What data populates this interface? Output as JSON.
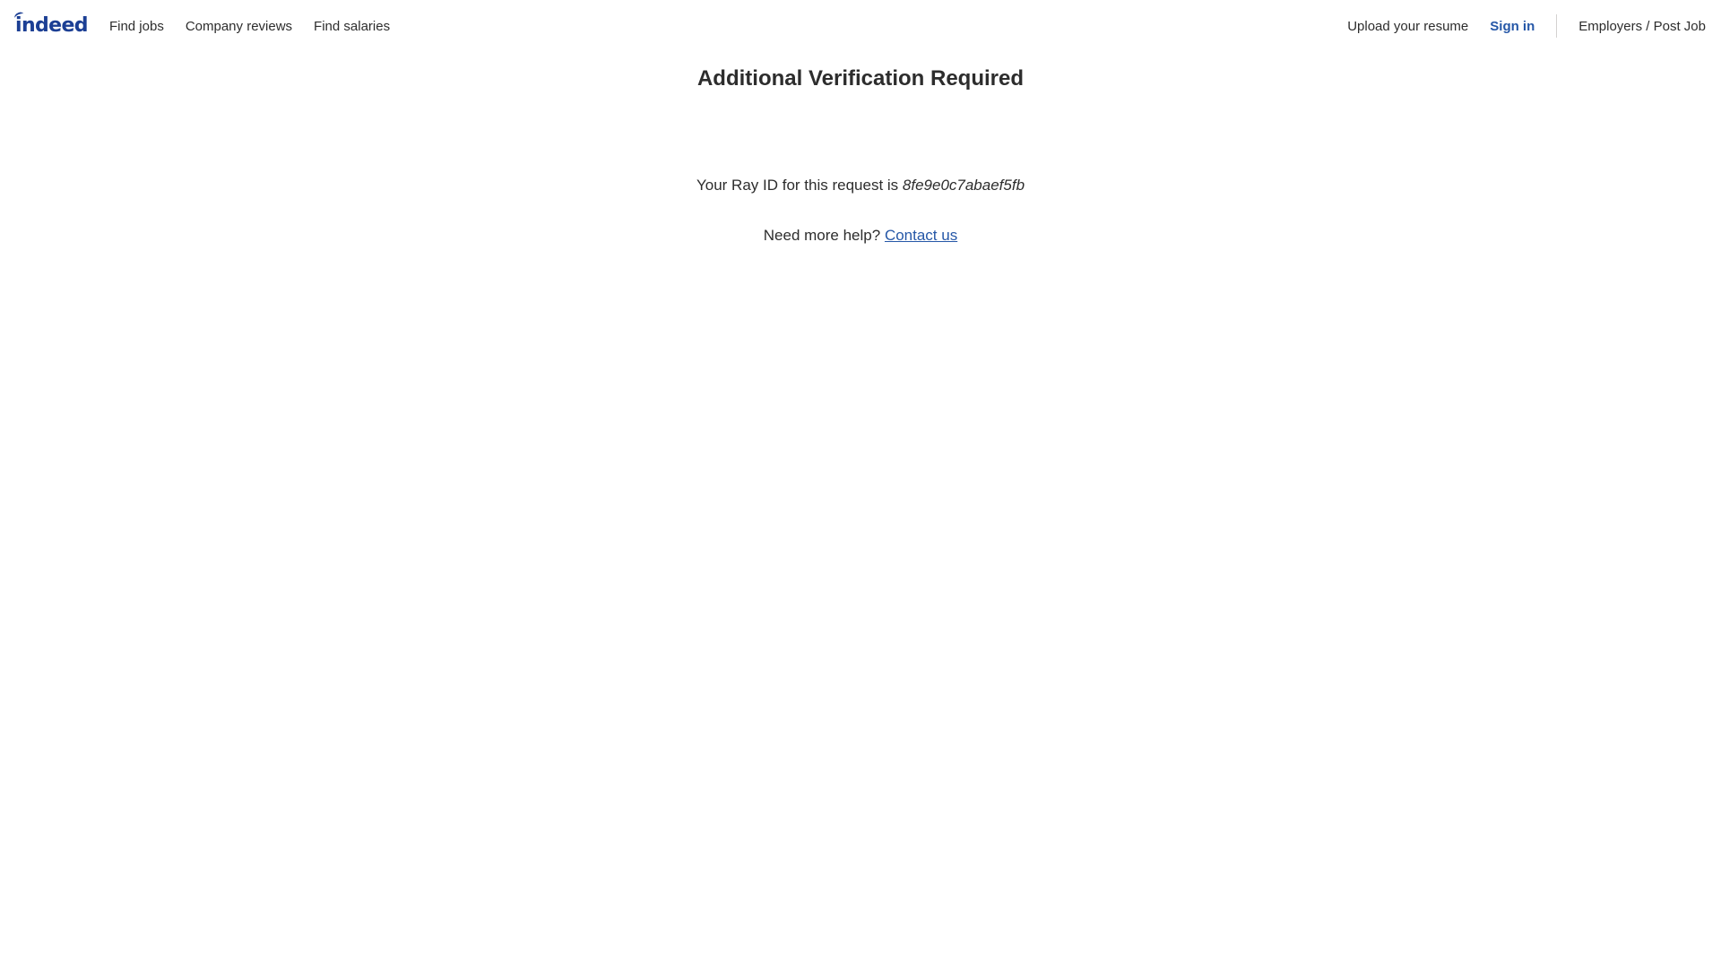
{
  "header": {
    "logo_text": "indeed",
    "nav_left": [
      {
        "label": "Find jobs"
      },
      {
        "label": "Company reviews"
      },
      {
        "label": "Find salaries"
      }
    ],
    "upload_label": "Upload your resume",
    "signin_label": "Sign in",
    "employers_label": "Employers / Post Job"
  },
  "main": {
    "title": "Additional Verification Required",
    "ray_prefix": "Your Ray ID for this request is",
    "ray_id": "8fe9e0c7abaef5fb",
    "help_prefix": "Need more help?",
    "contact_label": "Contact us"
  },
  "colors": {
    "brand": "#1c3f94",
    "link": "#2557a7",
    "text": "#2d2d2d",
    "divider": "#d4d2d0"
  }
}
